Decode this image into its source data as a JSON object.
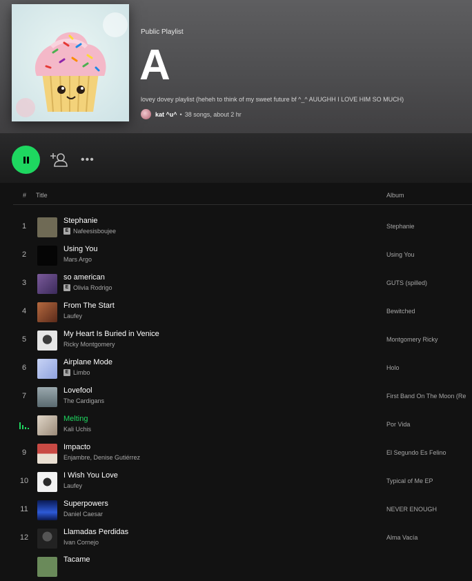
{
  "playlist": {
    "type_label": "Public Playlist",
    "title": "A",
    "description": "lovey dovey playlist (heheh to think of my sweet future bf ^_^ AUUGHH I LOVE HIM SO MUCH)",
    "owner": "kat ^u^",
    "meta": "38 songs, about 2 hr"
  },
  "actions": {
    "play_icon": "pause-icon",
    "add_icon": "add-user-icon",
    "more_icon": "more-options-icon"
  },
  "columns": {
    "num": "#",
    "title": "Title",
    "album": "Album"
  },
  "colors": {
    "accent": "#1ed760",
    "background": "#121212"
  },
  "tracks": [
    {
      "num": "1",
      "title": "Stephanie",
      "artist": "Nafeesisboujee",
      "album": "Stephanie",
      "explicit": true,
      "art": "#6f6a55"
    },
    {
      "num": "2",
      "title": "Using You",
      "artist": "Mars Argo",
      "album": "Using You",
      "explicit": false,
      "art": "#050505"
    },
    {
      "num": "3",
      "title": "so american",
      "artist": "Olivia Rodrigo",
      "album": "GUTS (spilled)",
      "explicit": true,
      "art": "#5a4a7a"
    },
    {
      "num": "4",
      "title": "From The Start",
      "artist": "Laufey",
      "album": "Bewitched",
      "explicit": false,
      "art": "#8a4a30"
    },
    {
      "num": "5",
      "title": "My Heart Is Buried in Venice",
      "artist": "Ricky Montgomery",
      "album": "Montgomery Ricky",
      "explicit": false,
      "art": "#cfcfcf"
    },
    {
      "num": "6",
      "title": "Airplane Mode",
      "artist": "Limbo",
      "album": "Holo",
      "explicit": true,
      "art": "#a6b8e8"
    },
    {
      "num": "7",
      "title": "Lovefool",
      "artist": "The Cardigans",
      "album": "First Band On The Moon (Re",
      "explicit": false,
      "art": "#7c8a8f"
    },
    {
      "num": "",
      "title": "Melting",
      "artist": "Kali Uchis",
      "album": "Por Vida",
      "explicit": false,
      "art": "#c9c0b0",
      "playing": true
    },
    {
      "num": "9",
      "title": "Impacto",
      "artist": "Enjambre, Denise Gutiérrez",
      "album": "El Segundo Es Felino",
      "explicit": false,
      "art": "#b33b36"
    },
    {
      "num": "10",
      "title": "I Wish You Love",
      "artist": "Laufey",
      "album": "Typical of Me EP",
      "explicit": false,
      "art": "#f2f2f2"
    },
    {
      "num": "11",
      "title": "Superpowers",
      "artist": "Daniel Caesar",
      "album": "NEVER ENOUGH",
      "explicit": false,
      "art": "#1b3e9a"
    },
    {
      "num": "12",
      "title": "Llamadas Perdidas",
      "artist": "Ivan Cornejo",
      "album": "Alma Vacía",
      "explicit": false,
      "art": "#3a3a3a"
    },
    {
      "num": "",
      "title": "Tacame",
      "artist": "",
      "album": "",
      "explicit": false,
      "art": "#6a8a5a"
    }
  ]
}
